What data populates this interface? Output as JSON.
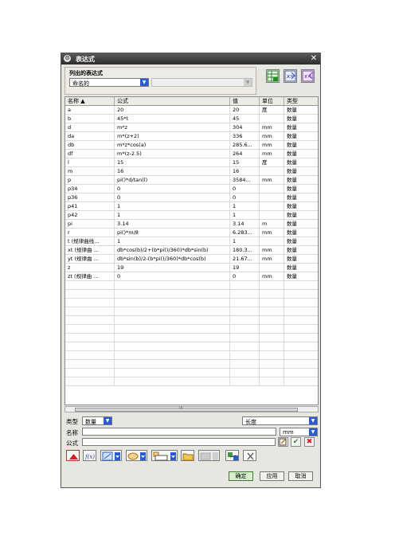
{
  "window": {
    "title": "表达式",
    "close_glyph": "✕"
  },
  "list_group": {
    "label": "列出的表达式",
    "filter_value": "命名的",
    "secondary_value": ""
  },
  "toolbar_icons": [
    "spreadsheet-icon",
    "import-expressions-icon",
    "export-expressions-icon"
  ],
  "table": {
    "headers": [
      "名称 ▲",
      "公式",
      "值",
      "单位",
      "类型"
    ],
    "rows": [
      [
        "a",
        "20",
        "20",
        "度",
        "数量"
      ],
      [
        "b",
        "45*t",
        "45",
        "",
        "数量"
      ],
      [
        "d",
        "m*z",
        "304",
        "mm",
        "数量"
      ],
      [
        "da",
        "m*(z+2)",
        "336",
        "mm",
        "数量"
      ],
      [
        "db",
        "m*z*cos(a)",
        "285.6...",
        "mm",
        "数量"
      ],
      [
        "df",
        "m*(z-2.5)",
        "264",
        "mm",
        "数量"
      ],
      [
        "l",
        "15",
        "15",
        "度",
        "数量"
      ],
      [
        "m",
        "16",
        "16",
        "",
        "数量"
      ],
      [
        "p",
        "pi()*d/tan(l)",
        "3584...",
        "mm",
        "数量"
      ],
      [
        "p34",
        "0",
        "0",
        "",
        "数量"
      ],
      [
        "p36",
        "0",
        "0",
        "",
        "数量"
      ],
      [
        "p41",
        "1",
        "1",
        "",
        "数量"
      ],
      [
        "p42",
        "1",
        "1",
        "",
        "数量"
      ],
      [
        "pi",
        "3.14",
        "3.14",
        "m",
        "数量"
      ],
      [
        "r",
        "pi()*m/8",
        "6.283...",
        "mm",
        "数量"
      ],
      [
        "t (规律曲线...",
        "1",
        "1",
        "",
        "数量"
      ],
      [
        "xt (规律曲 ...",
        "db*cos(b)/2+(b*pi()/360)*db*sin(b)",
        "180.3...",
        "mm",
        "数量"
      ],
      [
        "yt (规律曲 ...",
        "db*sin(b)/2-(b*pi()/360)*db*cos(b)",
        "21.67...",
        "mm",
        "数量"
      ],
      [
        "z",
        "19",
        "19",
        "",
        "数量"
      ],
      [
        "zt (规律曲 ...",
        "0",
        "0",
        "mm",
        "数量"
      ]
    ],
    "empty_rows": 12,
    "scroll_label": "III"
  },
  "type_row": {
    "label": "类型",
    "type_value": "数量",
    "dimension_value": "长度"
  },
  "name_row": {
    "label": "名称",
    "value": "",
    "unit_value": "mm"
  },
  "formula_row": {
    "label": "公式",
    "value": ""
  },
  "buttons": {
    "ok": "确定",
    "apply": "应用",
    "cancel": "取消"
  },
  "colors": {
    "title_bar": "#3a3a3a",
    "accent_blue": "#2a5bd0",
    "ok_green": "#3e7a2e",
    "delete_red": "#d02020"
  }
}
